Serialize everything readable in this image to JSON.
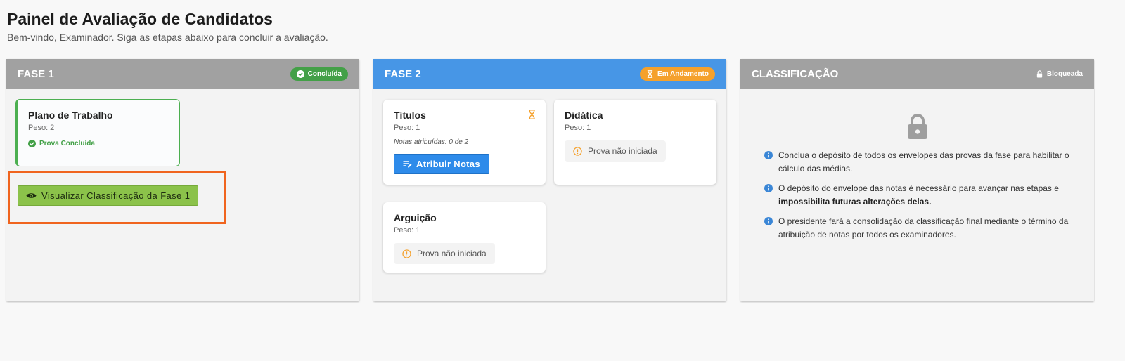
{
  "page": {
    "title": "Painel de Avaliação de Candidatos",
    "subtitle": "Bem-vindo, Examinador. Siga as etapas abaixo para concluir a avaliação."
  },
  "colors": {
    "phase_header_gray": "#a1a1a1",
    "phase_header_blue": "#4796e6",
    "status_green": "#43a047",
    "status_orange": "#f5a12c",
    "primary_button": "#2e8bea",
    "success_button": "#8bc24a",
    "highlight_border": "#f0641e"
  },
  "phase1": {
    "title": "FASE 1",
    "status": "Concluída",
    "status_icon": "check-circle-icon",
    "card": {
      "title": "Plano de Trabalho",
      "weight": "Peso: 2",
      "status": "Prova Concluída",
      "status_icon": "check-circle-icon"
    },
    "view_button": {
      "label": "Visualizar Classificação da Fase 1",
      "icon": "eye-icon"
    }
  },
  "phase2": {
    "title": "FASE 2",
    "status": "Em Andamento",
    "status_icon": "hourglass-icon",
    "cards": [
      {
        "title": "Títulos",
        "weight": "Peso: 1",
        "notes": "Notas atribuídas: 0 de 2",
        "button_label": "Atribuir Notas",
        "button_icon": "edit-list-icon",
        "status_icon": "hourglass-icon"
      },
      {
        "title": "Didática",
        "weight": "Peso: 1",
        "status": "Prova não iniciada",
        "status_icon": "info-circle-icon"
      },
      {
        "title": "Arguição",
        "weight": "Peso: 1",
        "status": "Prova não iniciada",
        "status_icon": "info-circle-icon"
      }
    ]
  },
  "classification": {
    "title": "CLASSIFICAÇÃO",
    "status": "Bloqueada",
    "status_icon": "lock-icon",
    "info": [
      {
        "text": "Conclua o depósito de todos os envelopes das provas da fase para habilitar o cálculo das médias."
      },
      {
        "text": "O depósito do envelope das notas é necessário para avançar nas etapas e ",
        "bold": "impossibilita futuras alterações delas."
      },
      {
        "text": "O presidente fará a consolidação da classificação final mediante o término da atribuição de notas por todos os examinadores."
      }
    ]
  }
}
